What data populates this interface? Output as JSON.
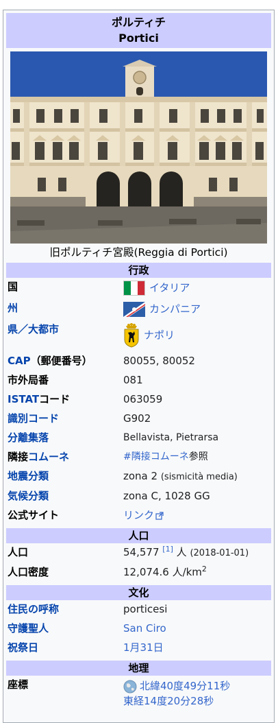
{
  "title": {
    "ja": "ポルティチ",
    "it": "Portici"
  },
  "photo_caption": "旧ポルティチ宮殿(Reggia di Portici)",
  "sections": {
    "admin": "行政",
    "population": "人口",
    "culture": "文化",
    "geography": "地理"
  },
  "admin": {
    "country_label": "国",
    "country_value": "イタリア",
    "region_label": "州",
    "region_value": "カンパニア",
    "province_label": "県／大都市",
    "province_value": "ナポリ",
    "cap_label_link": "CAP",
    "cap_label_rest": "（郵便番号）",
    "cap_value": "80055, 80052",
    "phone_label": "市外局番",
    "phone_value": "081",
    "istat_label_link": "ISTAT",
    "istat_label_rest": "コード",
    "istat_value": "063059",
    "id_label": "識別コード",
    "id_value": "G902",
    "frazioni_label": "分離集落",
    "frazioni_value": "Bellavista, Pietrarsa",
    "adjacent_label_plain": "隣接",
    "adjacent_label_link": "コムーネ",
    "adjacent_value": "#隣接コムーネ",
    "adjacent_value_suffix": "参照",
    "seismic_label": "地震分類",
    "seismic_value": "zona 2",
    "seismic_note": "(sismicità media)",
    "climate_label": "気候分類",
    "climate_value": "zona C, 1028 GG",
    "website_label": "公式サイト",
    "website_value": "リンク"
  },
  "population": {
    "pop_label": "人口",
    "pop_value": "54,577",
    "pop_ref": "[1]",
    "pop_unit": "人",
    "pop_date": "(2018-01-01)",
    "density_label": "人口密度",
    "density_value": "12,074.6 人/km",
    "density_exp": "2"
  },
  "culture": {
    "demonym_label": "住民の呼称",
    "demonym_value": "porticesi",
    "patron_label": "守護聖人",
    "patron_value": "San Ciro",
    "feast_label": "祝祭日",
    "feast_value": "1月31日"
  },
  "geography": {
    "coord_label": "座標",
    "coord_lat": "北緯40度49分11秒",
    "coord_lon": "東経14度20分28秒"
  },
  "colors": {
    "header_bg": "#ccccff",
    "link": "#0645ad",
    "link_visited_light": "#3366cc",
    "italy_flag": [
      "#009246",
      "#ffffff",
      "#ce2b37"
    ]
  }
}
